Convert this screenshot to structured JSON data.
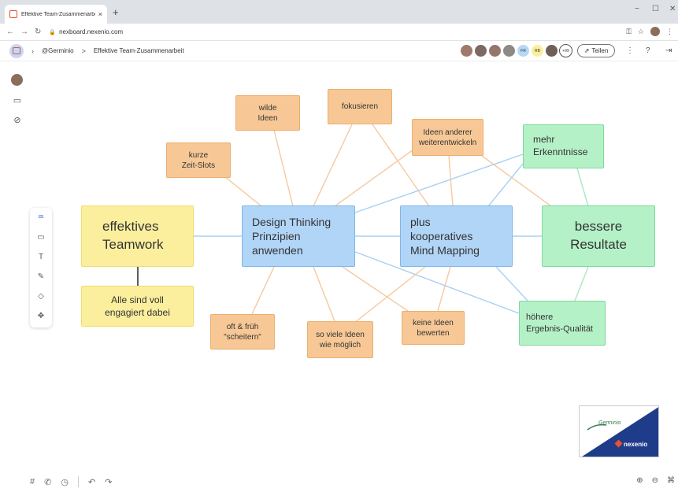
{
  "browser": {
    "tab_title": "Effektive Team-Zusammenarbeit",
    "tab_close": "×",
    "new_tab": "+",
    "url": "nexboard.nexenio.com",
    "win_minimize": "−",
    "win_maximize": "☐",
    "win_close": "✕"
  },
  "header": {
    "user": "@Germinio",
    "separator": ">",
    "board_title": "Effektive Team-Zusammenarbeit",
    "avatar_initials": [
      "FR",
      "RB"
    ],
    "participants_more": "+99",
    "share_label": "Teilen"
  },
  "notes": {
    "wilde_ideen": "wilde\nIdeen",
    "fokusieren": "fokusieren",
    "ideen_anderer": "Ideen anderer\nweiterentwickeln",
    "mehr_erkenntnisse": "mehr\nErkenntnisse",
    "kurze_zeit_slots": "kurze\nZeit-Slots",
    "effektives_teamwork": "effektives\nTeamwork",
    "design_thinking": "Design Thinking\nPrinzipien\nanwenden",
    "mind_mapping": "plus\nkooperatives\nMind Mapping",
    "bessere_resultate": "bessere\nResultate",
    "alle_engagiert": "Alle sind voll\nengagiert dabei",
    "oft_frueh": "oft & früh\n\"scheitern\"",
    "so_viele_ideen": "so viele Ideen\nwie möglich",
    "keine_ideen_bewerten": "keine Ideen\nbewerten",
    "hoehere_qualitaet": "höhere\nErgebnis-Qualität"
  },
  "logo": {
    "germinio": "Germinio",
    "nexenio": "nexenio"
  },
  "colors": {
    "orange_note": "#f7c896",
    "yellow_note": "#fbef9d",
    "blue_note": "#b1d5f7",
    "green_note": "#b5f1c7",
    "orange_line": "#f5c9a0",
    "blue_line": "#a9d0f2",
    "green_line": "#a9e8bd",
    "logo_blue": "#1f3c8a"
  }
}
